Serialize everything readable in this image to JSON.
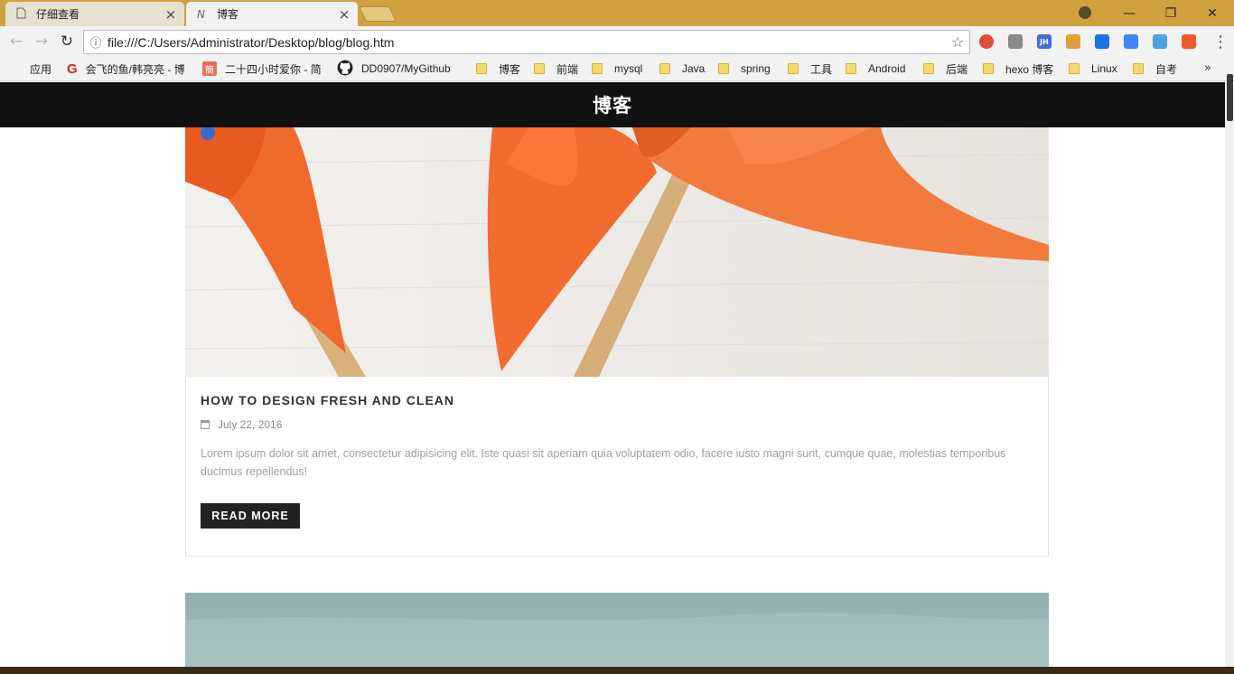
{
  "browser": {
    "tabs": [
      {
        "title": "仔细查看",
        "icon": "page-icon",
        "active": false
      },
      {
        "title": "博客",
        "icon": "N",
        "active": true
      }
    ],
    "close_glyph": "×",
    "url": "file:///C:/Users/Administrator/Desktop/blog/blog.htm",
    "window_controls": {
      "minimize": "—",
      "restore": "❐",
      "close": "✕"
    },
    "nav": {
      "back": "←",
      "forward": "→",
      "reload": "↻"
    },
    "info_glyph": "ⓘ",
    "star_glyph": "☆",
    "extensions": [
      {
        "name": "chrome-icon",
        "label": "",
        "color": "#e24a3b"
      },
      {
        "name": "download-icon",
        "label": "",
        "color": "#8a8a8a"
      },
      {
        "name": "jh-icon",
        "label": "JH",
        "color": "#3f6fd8"
      },
      {
        "name": "color-picker-icon",
        "label": "",
        "color": "#e2a03b"
      },
      {
        "name": "pocket-icon",
        "label": "",
        "color": "#1a73e8"
      },
      {
        "name": "translate-icon",
        "label": "",
        "color": "#4285f4"
      },
      {
        "name": "qr-icon",
        "label": "",
        "color": "#4aa3df"
      },
      {
        "name": "circle-ext-icon",
        "label": "",
        "color": "#f1592a"
      }
    ],
    "bookmarks": [
      {
        "label": "应用",
        "icon": "apps"
      },
      {
        "label": "会飞的鱼/韩亮亮 - 博",
        "icon": "g"
      },
      {
        "label": "二十四小时爱你 - 简",
        "icon": "jian"
      },
      {
        "label": "DD0907/MyGithub",
        "icon": "github"
      },
      {
        "label": "博客",
        "icon": "folder"
      },
      {
        "label": "前端",
        "icon": "folder"
      },
      {
        "label": "mysql",
        "icon": "folder"
      },
      {
        "label": "Java",
        "icon": "folder"
      },
      {
        "label": "spring",
        "icon": "folder"
      },
      {
        "label": "工具",
        "icon": "folder"
      },
      {
        "label": "Android",
        "icon": "folder"
      },
      {
        "label": "后端",
        "icon": "folder"
      },
      {
        "label": "hexo 博客",
        "icon": "folder"
      },
      {
        "label": "Linux",
        "icon": "folder"
      },
      {
        "label": "自考",
        "icon": "folder"
      }
    ],
    "bookmarks_more": "»",
    "menu": "⋮"
  },
  "page": {
    "site_title": "博客",
    "post": {
      "title": "HOW TO DESIGN FRESH AND CLEAN",
      "date": "July 22, 2016",
      "excerpt": "Lorem ipsum dolor sit amet, consectetur adipisicing elit. Iste quasi sit aperiam quia voluptatem odio, facere iusto magni sunt, cumque quae, molestias temporibus ducimus repellendus!",
      "read_more": "READ MORE"
    }
  }
}
